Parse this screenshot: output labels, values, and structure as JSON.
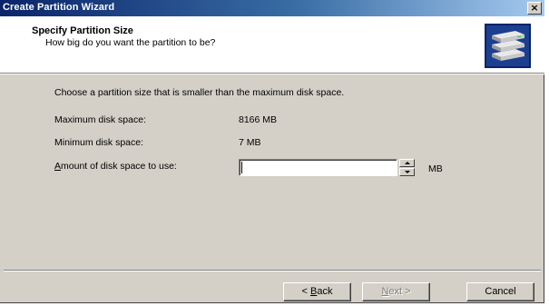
{
  "window": {
    "title": "Create Partition Wizard",
    "close_glyph": "×"
  },
  "header": {
    "title": "Specify Partition Size",
    "subtitle": "How big do you want the partition to be?",
    "icon": "disk-stack-icon"
  },
  "body": {
    "instruction": "Choose a partition size that is smaller than the maximum disk space.",
    "max_label": "Maximum disk space:",
    "max_value": "8166 MB",
    "min_label": "Minimum disk space:",
    "min_value": "7 MB",
    "amount_label_accel": "A",
    "amount_label_rest": "mount of disk space to use:",
    "amount_value": "",
    "amount_unit": "MB"
  },
  "buttons": {
    "back_prefix": "< ",
    "back_accel": "B",
    "back_rest": "ack",
    "next_accel": "N",
    "next_rest": "ext >",
    "cancel": "Cancel"
  }
}
